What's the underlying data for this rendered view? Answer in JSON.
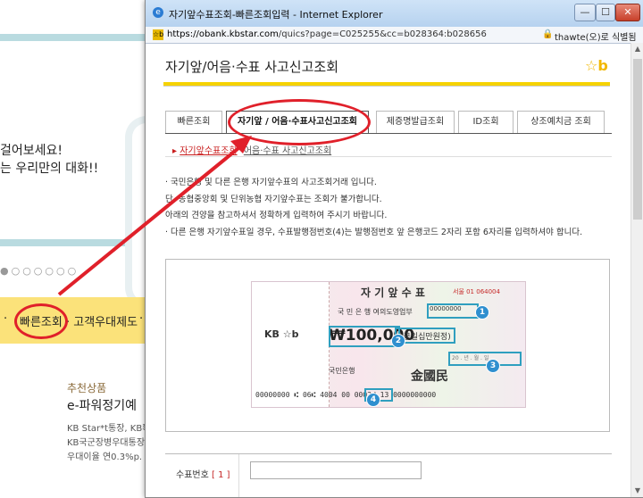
{
  "background": {
    "line1": "걸어보세요!",
    "line2": "는 우리만의 대화!!",
    "dots": "●○○○○○○",
    "nav": {
      "item1": "빠른조회",
      "item2": "· 고객우대제도",
      "item3": "·",
      "dot_before": "·"
    },
    "recommend": {
      "label": "추천상품",
      "title": "e-파워정기예",
      "desc1": "KB Star*t통장, KB확",
      "desc2": "KB국군장병우대통장",
      "desc3": "우대이율 연0.3%p."
    }
  },
  "window": {
    "title": "자기앞수표조회-빠른조회입력 - Internet Explorer",
    "ie_icon": "e",
    "minimize": "—",
    "maximize": "☐",
    "close": "✕",
    "address": {
      "url_host": "https://obank.kbstar.com",
      "url_path": "/quics?page=C025255&cc=b028364:b028656",
      "cert": "thawte(오)로 식별됨",
      "lock_icon": "lock-icon"
    }
  },
  "page": {
    "title": "자기앞/어음·수표 사고신고조회",
    "logo": "☆b",
    "tabs": [
      {
        "label": "빠른조회"
      },
      {
        "label": "자기앞 / 어음·수표사고신고조회",
        "active": true
      },
      {
        "label": "제증명발급조회"
      },
      {
        "label": "ID조회"
      },
      {
        "label": "상조예치금 조회"
      }
    ],
    "subnav": {
      "active": "자기앞수표조회",
      "other": "어음·수표 사고신고조회",
      "bullet": "▸"
    },
    "notes": [
      "· 국민은행 및 다른 은행 자기앞수표의 사고조회거래 입니다.",
      "  단, 농협중앙회 및 단위농협 자기앞수표는 조회가 불가합니다.",
      "  아래의 견양을 참고하셔서 정확하게 입력하여 주시기 바랍니다.",
      "· 다른 은행 자기앞수표일 경우, 수표발행점번호(4)는 발행점번호 앞 은행코드 2자리 포함 6자리를 입력하셔야 합니다."
    ],
    "check": {
      "head": "자 기 앞 수 표",
      "bank": "국 민 은 행   여의도영업부",
      "amount": "₩100,000",
      "amount_kr": "(금일십만원정)",
      "serial_red": "서울 01\n064004",
      "serial": "00000000",
      "date": "20 . 년 . 월 . 일",
      "sign": "金國民",
      "bank2": "국민은행",
      "kb": "KB ☆b",
      "micr": "00000000 ⑆ 06⑆   4004 00   0002⑆   13   0000000000",
      "micr_hl": "4004",
      "badges": [
        "1",
        "2",
        "3",
        "4"
      ]
    },
    "form": {
      "label": "수표번호",
      "num": "[ 1 ]"
    }
  }
}
